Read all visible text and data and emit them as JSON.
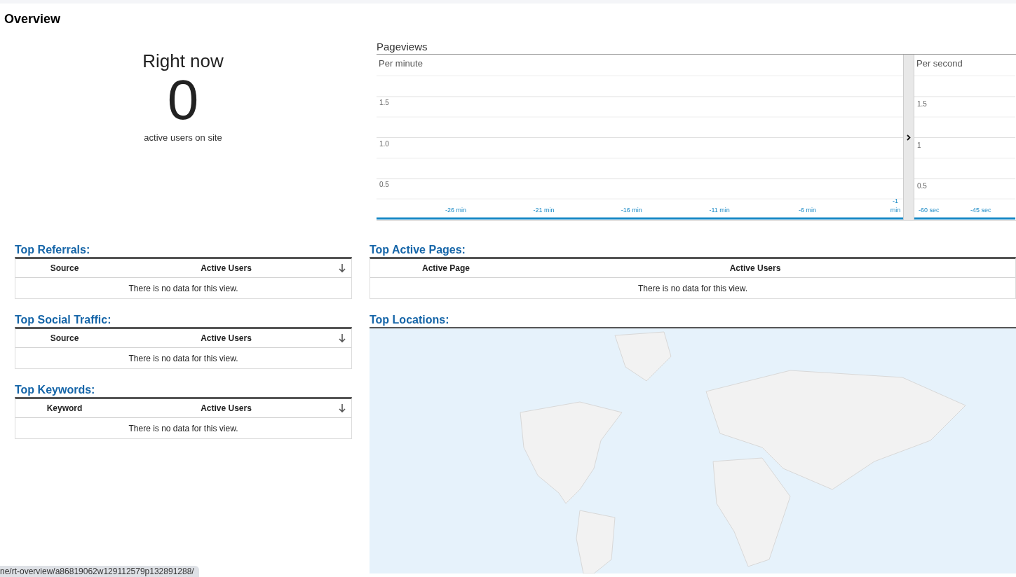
{
  "page_title": "Overview",
  "right_now": {
    "label": "Right now",
    "count": "0",
    "caption": "active users on site"
  },
  "pageviews": {
    "title": "Pageviews",
    "per_minute": {
      "label": "Per minute",
      "y_labels": [
        "1.5",
        "1.0",
        "0.5"
      ],
      "x_labels": [
        "-26 min",
        "-21 min",
        "-16 min",
        "-11 min",
        "-6 min",
        "-1 min"
      ]
    },
    "per_second": {
      "label": "Per second",
      "y_labels": [
        "1.5",
        "1",
        "0.5"
      ],
      "x_labels": [
        "-60 sec",
        "-45 sec"
      ]
    }
  },
  "left_tables": [
    {
      "title": "Top Referrals:",
      "columns": [
        "Source",
        "Active Users"
      ],
      "empty": "There is no data for this view."
    },
    {
      "title": "Top Social Traffic:",
      "columns": [
        "Source",
        "Active Users"
      ],
      "empty": "There is no data for this view."
    },
    {
      "title": "Top Keywords:",
      "columns": [
        "Keyword",
        "Active Users"
      ],
      "empty": "There is no data for this view."
    }
  ],
  "top_active_pages": {
    "title": "Top Active Pages:",
    "columns": [
      "Active Page",
      "Active Users"
    ],
    "empty": "There is no data for this view."
  },
  "top_locations": {
    "title": "Top Locations:"
  },
  "status_bar": {
    "url": "ne/rt-overview/a86819062w129112579p132891288/"
  }
}
